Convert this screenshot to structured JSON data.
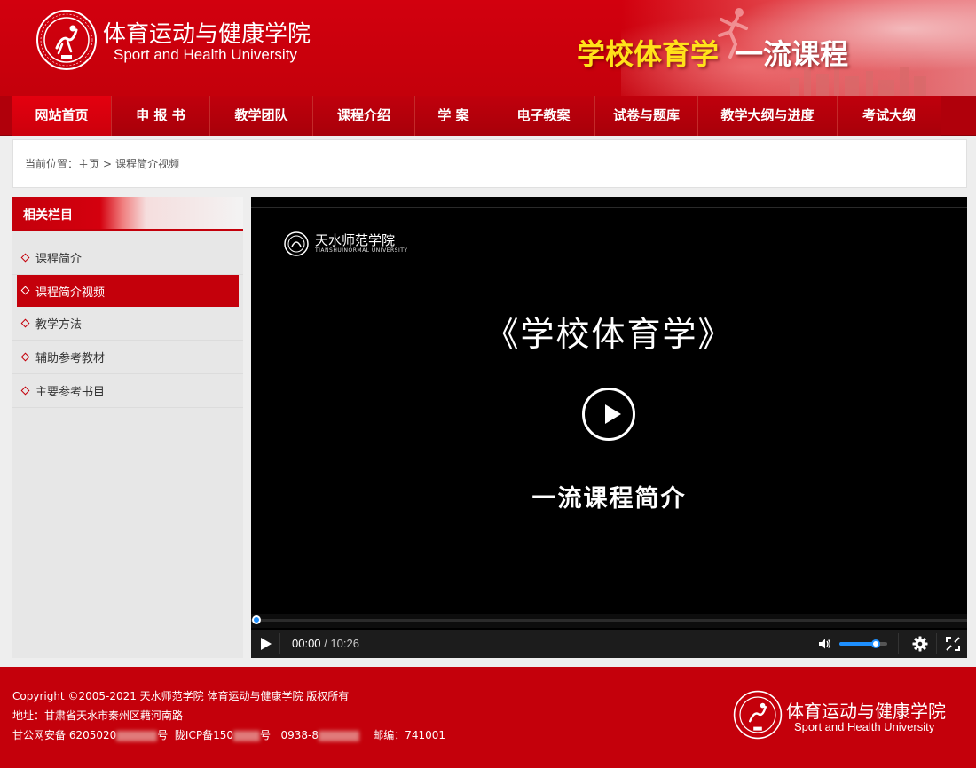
{
  "header": {
    "site_name_cn": "体育运动与健康学院",
    "site_name_en": "Sport and Health University",
    "slogan_primary": "学校体育学",
    "slogan_secondary": "一流课程",
    "brand_color": "#c4000b",
    "slogan_color": "#ffe21a"
  },
  "nav": {
    "items": [
      {
        "label": "网站首页",
        "active": true
      },
      {
        "label": "申 报 书",
        "active": false
      },
      {
        "label": "教学团队",
        "active": false
      },
      {
        "label": "课程介绍",
        "active": false
      },
      {
        "label": "学 案",
        "active": false
      },
      {
        "label": "电子教案",
        "active": false
      },
      {
        "label": "试卷与题库",
        "active": false
      },
      {
        "label": "教学大纲与进度",
        "active": false
      },
      {
        "label": "考试大纲",
        "active": false
      }
    ]
  },
  "breadcrumb": {
    "prefix": "当前位置：",
    "home": "主页",
    "separator": ">",
    "current": "课程简介视频"
  },
  "sidebar": {
    "title": "相关栏目",
    "items": [
      {
        "label": "课程简介",
        "active": false
      },
      {
        "label": "课程简介视频",
        "active": true
      },
      {
        "label": "教学方法",
        "active": false
      },
      {
        "label": "辅助参考教材",
        "active": false
      },
      {
        "label": "主要参考书目",
        "active": false
      }
    ]
  },
  "video": {
    "school_name_cn": "天水师范学院",
    "school_name_en": "TIANSHUINORMAL UNIVERSITY",
    "title": "《学校体育学》",
    "subtitle": "一流课程简介",
    "current_time": "00:00",
    "time_separator": " / ",
    "duration": "10:26",
    "progress": 0,
    "volume": 0.75,
    "accent_color": "#1e90ff"
  },
  "footer": {
    "copyright": "Copyright ©2005-2021   天水师范学院 体育运动与健康学院 版权所有",
    "address": "地址：甘肃省天水市秦州区藉河南路",
    "police_record_prefix": "甘公网安备 6205020",
    "police_record_suffix": "号",
    "icp_prefix": "陇ICP备150",
    "icp_suffix": "号",
    "phone_prefix": "0938-8",
    "postcode": "邮编：741001",
    "site_name_cn": "体育运动与健康学院",
    "site_name_en": "Sport and Health University"
  }
}
